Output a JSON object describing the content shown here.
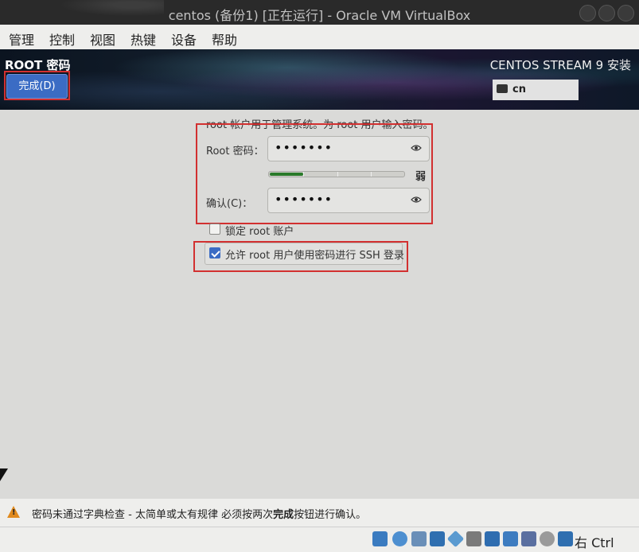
{
  "window": {
    "title": "centos (备份1) [正在运行] - Oracle VM VirtualBox"
  },
  "menu": {
    "items": [
      "管理",
      "控制",
      "视图",
      "热键",
      "设备",
      "帮助"
    ]
  },
  "header": {
    "section_title": "ROOT 密码",
    "done_label": "完成(D)",
    "install_title": "CENTOS STREAM 9 安装",
    "keyboard_layout": "cn"
  },
  "form": {
    "description": "root 帐户用于管理系统。为 root 用户输入密码。",
    "root_password_label": "Root 密码：",
    "root_password_value": "•••••••",
    "strength_label": "弱",
    "strength_fraction": 0.25,
    "confirm_label": "确认(C)：",
    "confirm_value": "•••••••",
    "lock_root": {
      "label": "锁定 root 账户",
      "checked": false
    },
    "allow_ssh": {
      "label": "允许 root 用户使用密码进行 SSH 登录",
      "checked": true
    }
  },
  "status": {
    "message_pre": "密码未通过字典检查 - 太简单或太有规律 必须按两次",
    "message_bold": "完成",
    "message_post": "按钮进行确认。"
  },
  "vbox_status": {
    "host_key": "右 Ctrl"
  },
  "colors": {
    "accent": "#3b6cc4",
    "highlight_box": "#d23030",
    "warning": "#e08a1e",
    "strength": "#2a7a2a"
  }
}
